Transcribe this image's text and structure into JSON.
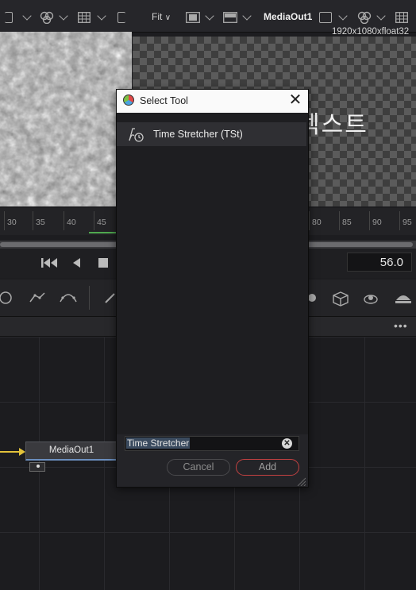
{
  "viewer": {
    "fit_label": "Fit",
    "right_viewer_name": "MediaOut1",
    "resolution_info": "1920x1080xfloat32",
    "overlay_text": "텍스트"
  },
  "timeline": {
    "ticks": [
      "30",
      "35",
      "40",
      "45",
      "80",
      "85",
      "90",
      "95"
    ],
    "current_frame": "56.0"
  },
  "node_graph": {
    "node_label": "MediaOut1"
  },
  "dialog": {
    "title": "Select Tool",
    "close_glyph": "✕",
    "items": [
      {
        "label": "Time Stretcher (TSt)",
        "icon": "time-stretcher-icon"
      }
    ],
    "search_value": "Time Stretcher",
    "cancel_label": "Cancel",
    "add_label": "Add"
  },
  "colors": {
    "add_button_border": "#c24141",
    "playhead_green": "#4fa84f",
    "connection_yellow": "#e2c23a",
    "node_underline": "#6b8fbf"
  }
}
